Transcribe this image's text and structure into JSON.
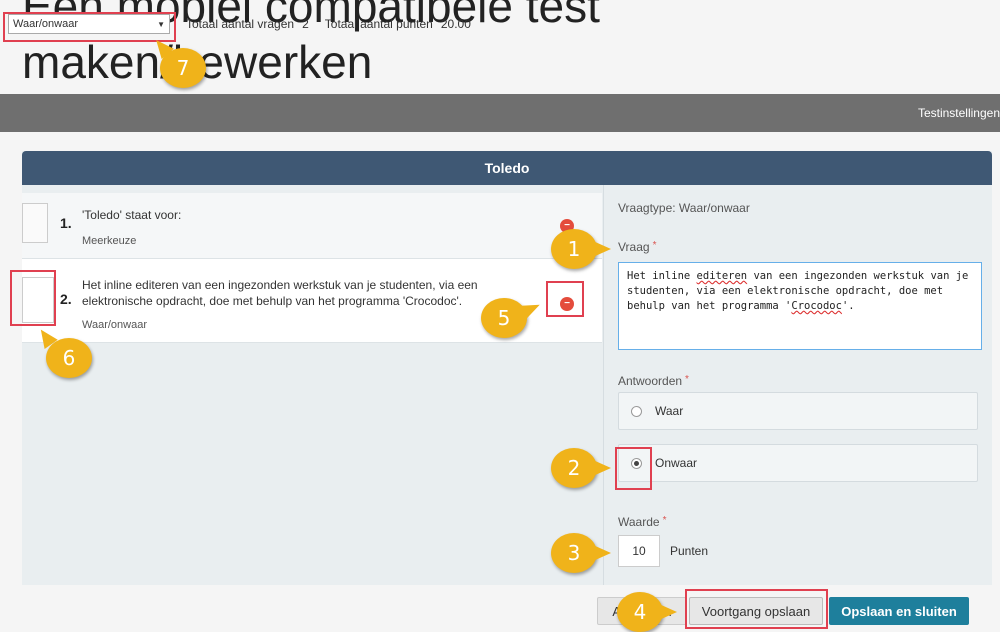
{
  "page": {
    "title_line1": "Een mobiel compatibele test",
    "title_line2": "maken/bewerken"
  },
  "topbar": {
    "question_type_select": "Waar/onwaar",
    "total_questions_label": "Totaal aantal vragen",
    "total_questions_value": "2",
    "total_points_label": "Totaal aantal punten",
    "total_points_value": "20.00"
  },
  "navband": {
    "settings_tab": "Testinstellingen"
  },
  "panel": {
    "title": "Toledo",
    "questions": [
      {
        "number": "1.",
        "text": "'Toledo' staat voor:",
        "type": "Meerkeuze"
      },
      {
        "number": "2.",
        "text": "Het inline editeren van een ingezonden werkstuk van je studenten, via een elektronische opdracht, doe met behulp van het programma 'Crocodoc'.",
        "type": "Waar/onwaar"
      }
    ]
  },
  "editor": {
    "question_type_label": "Vraagtype: Waar/onwaar",
    "question_label": "Vraag",
    "question_text_parts": [
      "Het inline ",
      "editeren",
      " van een ingezonden werkstuk van je studenten, via een elektronische opdracht, doe met behulp van het programma '",
      "Crocodoc",
      "'."
    ],
    "answers_label": "Antwoorden",
    "answers": [
      {
        "label": "Waar",
        "selected": false
      },
      {
        "label": "Onwaar",
        "selected": true
      }
    ],
    "value_label": "Waarde",
    "value": "10",
    "value_unit": "Punten"
  },
  "buttons": {
    "cancel": "Annuleren",
    "save_progress": "Voortgang opslaan",
    "save_and_close": "Opslaan en sluiten"
  },
  "annotations": {
    "callouts": [
      "1",
      "2",
      "3",
      "4",
      "5",
      "6",
      "7"
    ]
  },
  "colors": {
    "panel_header": "#3f5874",
    "nav_band": "#6f6f6f",
    "primary_button": "#1e7f9c",
    "callout": "#f0b31a",
    "highlight": "#e04050",
    "delete": "#e44c3c"
  }
}
